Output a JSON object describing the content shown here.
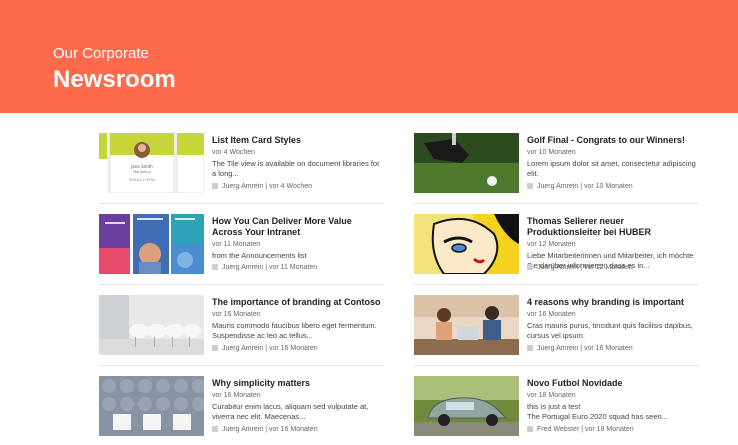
{
  "banner": {
    "subtitle": "Our Corporate",
    "title": "Newsroom"
  },
  "left_column": [
    {
      "title": "List Item Card Styles",
      "date": "vor 4 Wochen",
      "desc": "The Tile view is available on document libraries for a long...",
      "author": "Juerg Amrein",
      "meta_sep": "|",
      "meta_date": "vor 4 Wochen"
    },
    {
      "title": "How You Can Deliver More Value Across Your Intranet",
      "date": "vor 11 Monaten",
      "desc": "from the Announcements list",
      "author": "Juerg Amrein",
      "meta_sep": "|",
      "meta_date": "vor 11 Monaten"
    },
    {
      "title": "The importance of branding at Contoso",
      "date": "vor 16 Monaten",
      "desc": "Mauris commodo faucibus libero eget fermentum. Suspendisse ac leo ac tellus...",
      "author": "Juerg Amrein",
      "meta_sep": "|",
      "meta_date": "vor 16 Monaten"
    },
    {
      "title": "Why simplicity matters",
      "date": "vor 16 Monaten",
      "desc": "Curabitur enim lacus, aliquam sed vulputate at, viverra nec elit. Maecenas...",
      "author": "Juerg Amrein",
      "meta_sep": "|",
      "meta_date": "vor 16 Monaten"
    }
  ],
  "right_column": [
    {
      "title": "Golf Final - Congrats to our Winners!",
      "date": "vor 10 Monaten",
      "desc": "Lorem ipsum dolor sit amet, consectetur adipiscing elit.",
      "author": "Juerg Amrein",
      "meta_sep": "|",
      "meta_date": "vor 10 Monaten"
    },
    {
      "title": "Thomas Sellerer neuer Produktionsleiter bei HUBER",
      "date": "vor 12 Monaten",
      "desc": "Liebe Mitarbeiterinnen und Mitarbeiter, ich möchte Sie darüber informieren, dass es in...",
      "author": "Juerg Amrein",
      "meta_sep": "|",
      "meta_date": "vor 12 Monaten"
    },
    {
      "title": "4 reasons why branding is important",
      "date": "vor 16 Monaten",
      "desc": "Cras mauris purus, tincidunt quis facilisis dapibus, cursus vel ipsum.",
      "author": "Juerg Amrein",
      "meta_sep": "|",
      "meta_date": "vor 16 Monaten"
    },
    {
      "title": "Novo Futbol Novidade",
      "date": "vor 18 Monaten",
      "desc": "this is just a test\nThe Portugal Euro 2020 squad has seen...",
      "author": "Fred Webster",
      "meta_sep": "|",
      "meta_date": "vor 18 Monaten"
    }
  ],
  "tile_thumb": {
    "person_name": "Jane Smith",
    "person_role": "Marketing",
    "person_phone": "555-01 2 4790"
  },
  "colors": {
    "banner": "#ff6a4d",
    "divider": "#e6e6e6"
  }
}
